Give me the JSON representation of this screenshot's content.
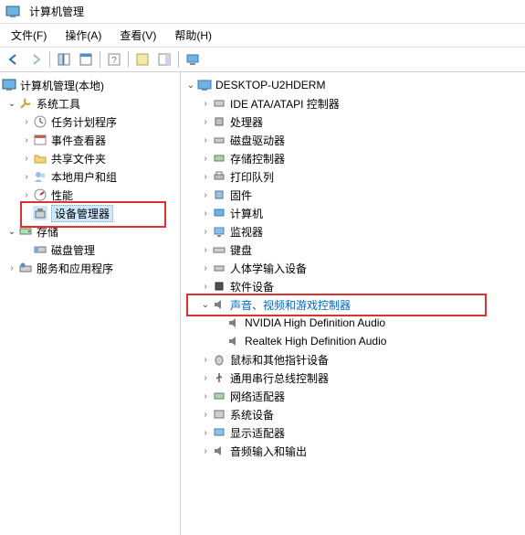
{
  "title": "计算机管理",
  "menu": {
    "file": "文件(F)",
    "action": "操作(A)",
    "view": "查看(V)",
    "help": "帮助(H)"
  },
  "left_tree": {
    "root": "计算机管理(本地)",
    "system_tools": "系统工具",
    "task_scheduler": "任务计划程序",
    "event_viewer": "事件查看器",
    "shared_folders": "共享文件夹",
    "local_users": "本地用户和组",
    "performance": "性能",
    "device_manager": "设备管理器",
    "storage": "存储",
    "disk_management": "磁盘管理",
    "services_apps": "服务和应用程序"
  },
  "right_tree": {
    "computer": "DESKTOP-U2HDERM",
    "ide": "IDE ATA/ATAPI 控制器",
    "processors": "处理器",
    "disk_drives": "磁盘驱动器",
    "storage_controllers": "存储控制器",
    "print_queues": "打印队列",
    "firmware": "固件",
    "computers": "计算机",
    "monitors": "监视器",
    "keyboards": "键盘",
    "hid": "人体学输入设备",
    "software_devices": "软件设备",
    "sound": "声音、视频和游戏控制器",
    "sound_child1": "NVIDIA High Definition Audio",
    "sound_child2": "Realtek High Definition Audio",
    "mice": "鼠标和其他指针设备",
    "usb": "通用串行总线控制器",
    "network": "网络适配器",
    "system_devices": "系统设备",
    "display": "显示适配器",
    "audio_io": "音频输入和输出"
  }
}
